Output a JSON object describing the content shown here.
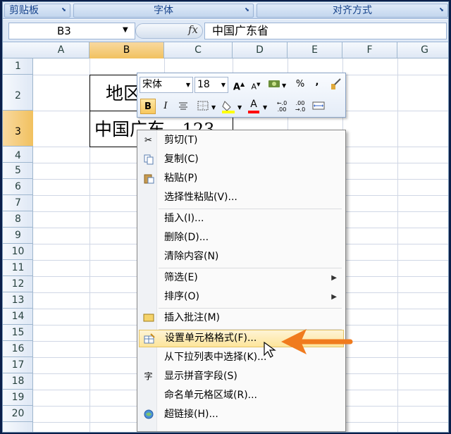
{
  "ribbon": {
    "groups": [
      "剪贴板",
      "字体",
      "对齐方式"
    ]
  },
  "formula_bar": {
    "name_box": "B3",
    "fx_label": "fx",
    "content": "中国广东省"
  },
  "grid": {
    "columns": [
      "A",
      "B",
      "C",
      "D",
      "E",
      "F",
      "G"
    ],
    "selected_column": "B",
    "rows": [
      "1",
      "2",
      "3",
      "4",
      "5",
      "6",
      "7",
      "8",
      "9",
      "10",
      "11",
      "12",
      "13",
      "14",
      "15",
      "16",
      "17",
      "18",
      "19",
      "20"
    ],
    "selected_row": "3",
    "cells": {
      "b2": "地区",
      "b3": "中国广东",
      "c3": "123"
    }
  },
  "mini_toolbar": {
    "font_name": "宋体",
    "font_size": "18",
    "grow_font": "A",
    "shrink_font": "A",
    "percent": "%",
    "comma": ",",
    "bold": "B",
    "italic": "I",
    "font_color_letter": "A",
    "inc_decimal": "+.0\n.00",
    "dec_decimal": ".00\n+.0",
    "highlight_color": "#ffff00",
    "font_color": "#ff0000"
  },
  "context_menu": {
    "items": [
      {
        "label": "剪切(T)",
        "icon": "scissors-icon"
      },
      {
        "label": "复制(C)",
        "icon": "copy-icon"
      },
      {
        "label": "粘贴(P)",
        "icon": "paste-icon"
      },
      {
        "label": "选择性粘贴(V)...",
        "icon": ""
      },
      {
        "label": "插入(I)...",
        "icon": ""
      },
      {
        "label": "删除(D)...",
        "icon": ""
      },
      {
        "label": "清除内容(N)",
        "icon": ""
      },
      {
        "label": "筛选(E)",
        "icon": "",
        "submenu": true
      },
      {
        "label": "排序(O)",
        "icon": "",
        "submenu": true
      },
      {
        "label": "插入批注(M)",
        "icon": "comment-icon"
      },
      {
        "label": "设置单元格格式(F)...",
        "icon": "format-cells-icon",
        "highlighted": true
      },
      {
        "label": "从下拉列表中选择(K)...",
        "icon": ""
      },
      {
        "label": "显示拼音字段(S)",
        "icon": "phonetic-icon"
      },
      {
        "label": "命名单元格区域(R)...",
        "icon": ""
      },
      {
        "label": "超链接(H)...",
        "icon": "hyperlink-icon"
      }
    ]
  },
  "colors": {
    "accent_arrow": "#f07b1e",
    "selected_header": "#f1c15f",
    "menu_highlight": "#fde59b"
  }
}
